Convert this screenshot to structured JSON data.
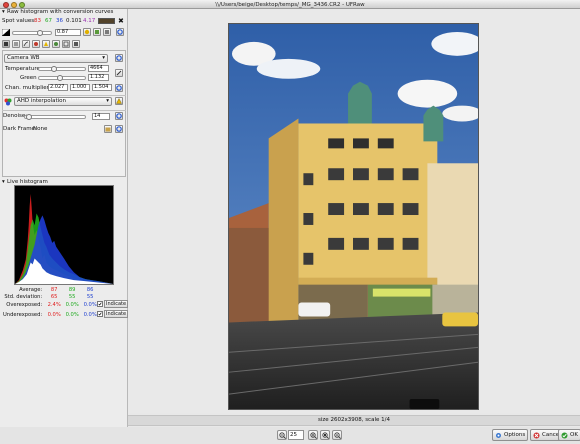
{
  "window": {
    "title": "\\\\/Users/beige/Desktop/temps/_MG_3436.CR2 - UFRaw"
  },
  "expander_raw": {
    "label": "Raw histogram with conversion curves"
  },
  "spot": {
    "label": "Spot values:",
    "r": "83",
    "g": "67",
    "b": "36",
    "v": "0.101",
    "l": "4.17"
  },
  "exposure": {
    "value": "0.87"
  },
  "wb": {
    "preset": "Camera WB",
    "temperature_label": "Temperature",
    "temperature": "4664",
    "green_label": "Green",
    "green": "1.132",
    "chan_label": "Chan. multipliers:",
    "chan": [
      "2.027",
      "1.000",
      "1.504"
    ]
  },
  "interp": {
    "value": "AHD interpolation"
  },
  "denoise": {
    "label": "Denoise:",
    "value": "14"
  },
  "darkframe": {
    "label": "Dark Frame:",
    "value": "None"
  },
  "live": {
    "label": "Live histogram"
  },
  "stats": {
    "rows": [
      {
        "label": "Average:",
        "r": "87",
        "g": "89",
        "b": "86"
      },
      {
        "label": "Std. deviation:",
        "r": "65",
        "g": "55",
        "b": "55"
      },
      {
        "label": "Overexposed:",
        "r": "2.4%",
        "g": "0.0%",
        "b": "0.0%"
      },
      {
        "label": "Underexposed:",
        "r": "0.0%",
        "g": "0.0%",
        "b": "0.0%"
      }
    ],
    "indicate_label": "Indicate"
  },
  "status": {
    "text": "size 2602x3908, scale 1/4"
  },
  "zoom": {
    "value": "25"
  },
  "buttons": {
    "options": "Options",
    "cancel": "Cancel",
    "ok": "OK"
  },
  "colors": {
    "red": "#e02020",
    "green": "#1faa1f",
    "blue": "#2040d0",
    "purple": "#9a2fb0",
    "swatch": "#53432a"
  }
}
